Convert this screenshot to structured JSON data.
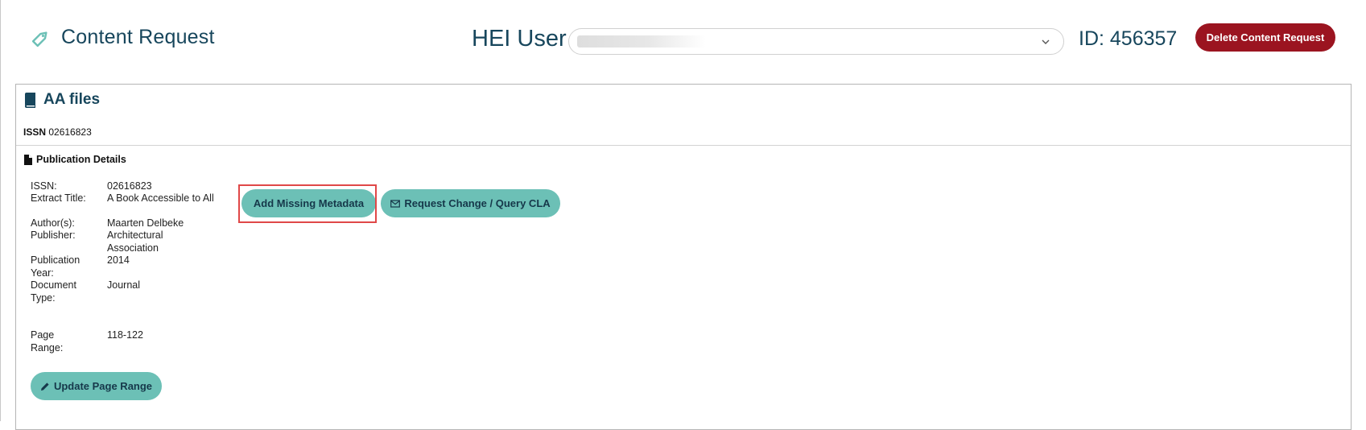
{
  "header": {
    "title": "Content Request",
    "user_label": "HEI User",
    "user_select_value": "",
    "id_text": "ID: 456357",
    "delete_label": "Delete Content Request"
  },
  "book": {
    "title": "AA files",
    "issn_key": "ISSN",
    "issn_value": "02616823"
  },
  "publication": {
    "heading": "Publication Details",
    "fields": [
      {
        "label": "ISSN:",
        "value": "02616823"
      },
      {
        "label": "Extract Title:",
        "value": "A Book Accessible to All"
      },
      {
        "label": "Author(s):",
        "value": "Maarten Delbeke"
      },
      {
        "label": "Publisher:",
        "value": "Architectural Association"
      },
      {
        "label": "Publication Year:",
        "value": "2014"
      },
      {
        "label": "Document Type:",
        "value": "Journal"
      },
      {
        "label": "Page Range:",
        "value": "118-122"
      }
    ]
  },
  "actions": {
    "add_metadata_label": "Add Missing Metadata",
    "query_label": "Request Change / Query CLA",
    "update_range_label": "Update Page Range"
  },
  "icons": {
    "title": "tag-icon",
    "book": "book-icon",
    "publication": "file-icon",
    "query": "envelope-icon",
    "update": "pencil-icon",
    "select": "chevron-down-icon"
  },
  "colors": {
    "primary_text": "#17465c",
    "teal_button": "#6cc0b6",
    "delete_button": "#9b1420",
    "highlight": "#e04848"
  }
}
